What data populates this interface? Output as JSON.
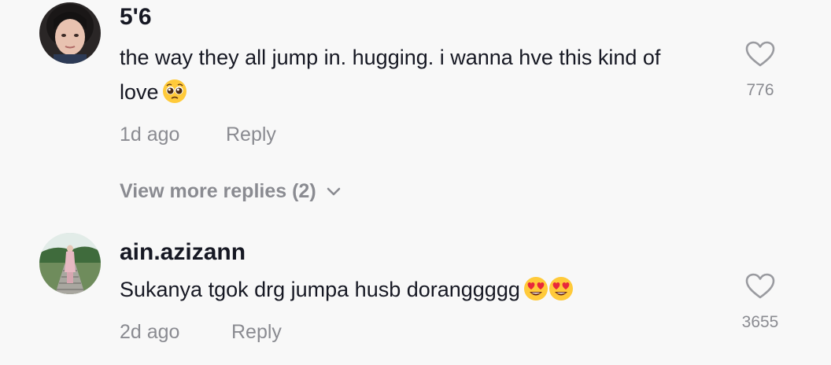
{
  "comments": [
    {
      "username": "5'6",
      "text": "the way they all jump in. hugging. i wanna hve this kind of love",
      "emoji": [
        "pleading-face"
      ],
      "time": "1d ago",
      "reply_label": "Reply",
      "like_count": "776",
      "view_more": "View more replies (2)"
    },
    {
      "username": "ain.azizann",
      "text": "Sukanya tgok drg jumpa husb doranggggg",
      "emoji": [
        "heart-eyes-face",
        "heart-eyes-face"
      ],
      "time": "2d ago",
      "reply_label": "Reply",
      "like_count": "3655"
    }
  ],
  "colors": {
    "background": "#f8f8f8",
    "primary_text": "#161823",
    "secondary_text": "#8a8b91"
  }
}
